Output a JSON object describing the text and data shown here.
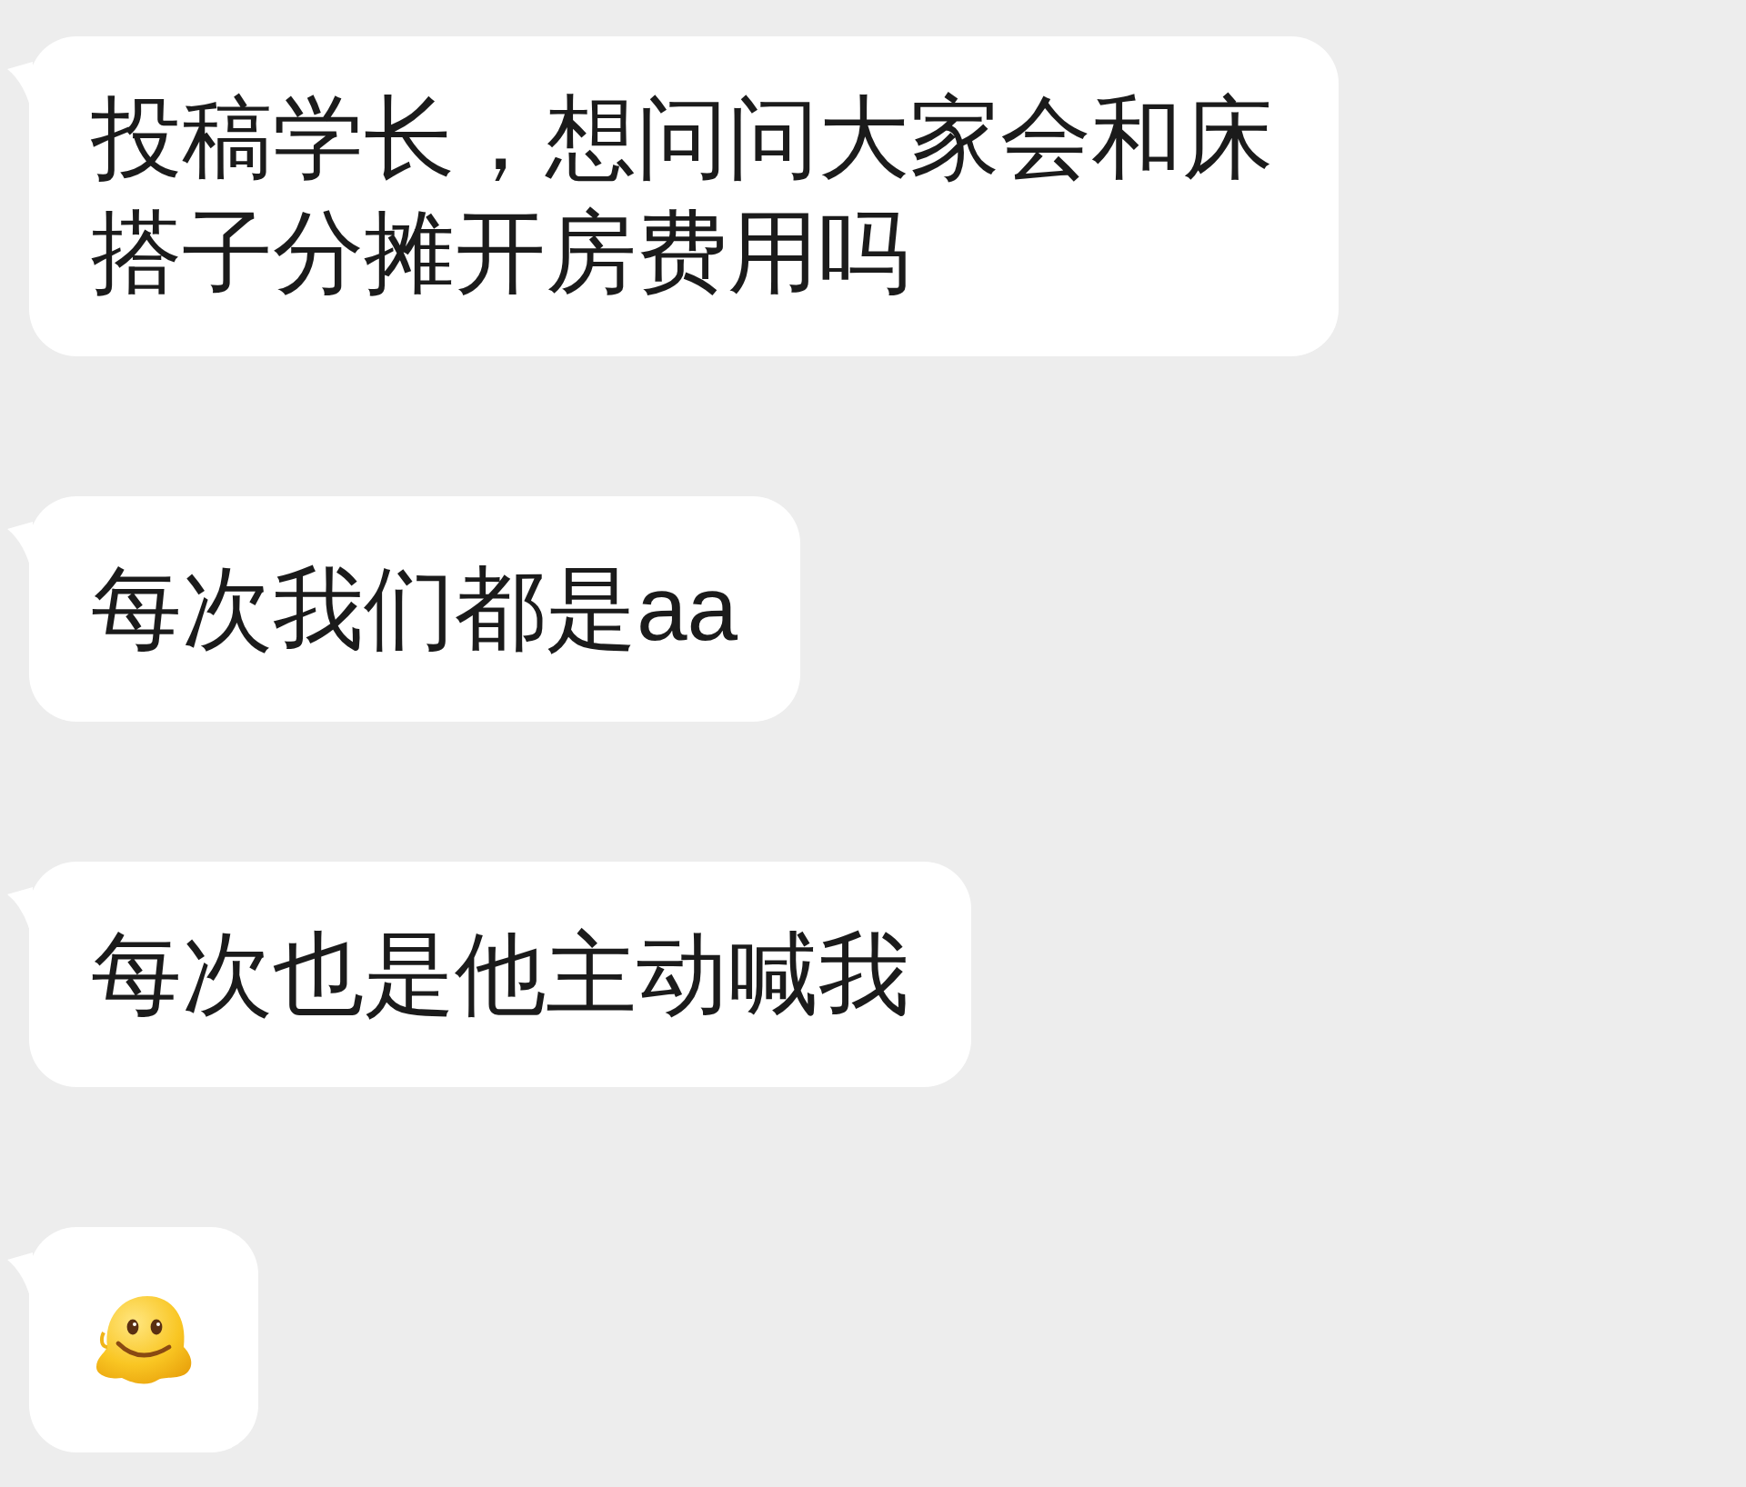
{
  "messages": [
    {
      "kind": "text",
      "text": "投稿学长，想问问大家会和床搭子分摊开房费用吗"
    },
    {
      "kind": "text",
      "text": "每次我们都是aa"
    },
    {
      "kind": "text",
      "text": "每次也是他主动喊我"
    },
    {
      "kind": "emoji"
    }
  ]
}
